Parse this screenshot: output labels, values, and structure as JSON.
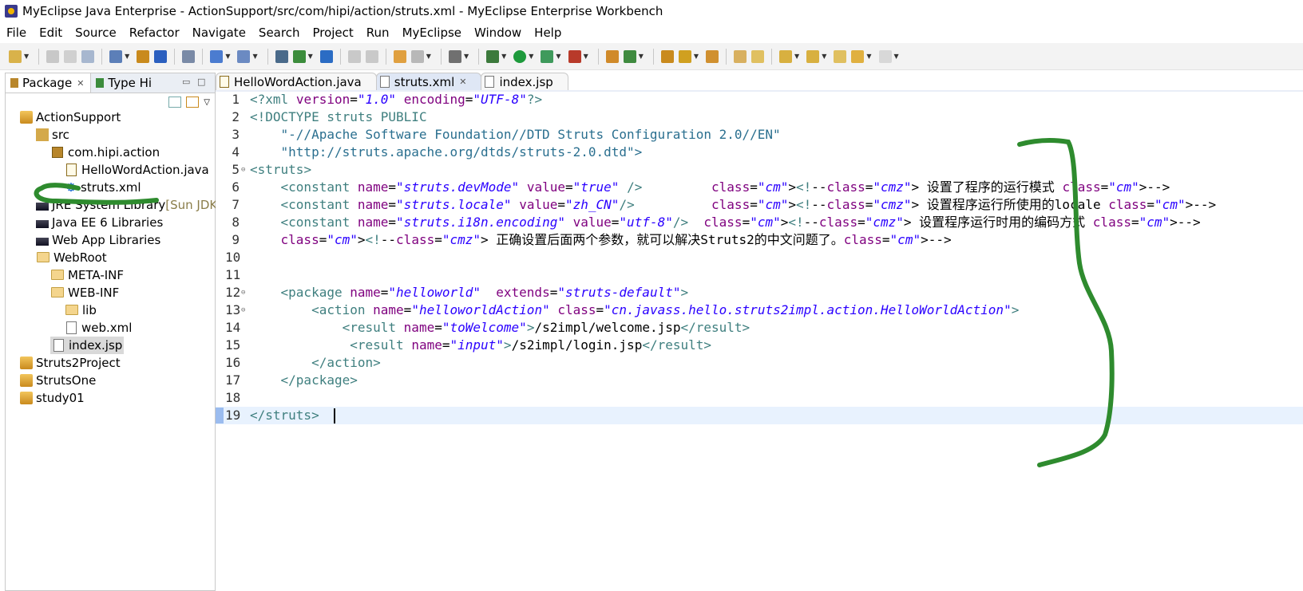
{
  "window": {
    "title": "MyEclipse Java Enterprise - ActionSupport/src/com/hipi/action/struts.xml - MyEclipse Enterprise Workbench"
  },
  "menu": [
    "File",
    "Edit",
    "Source",
    "Refactor",
    "Navigate",
    "Search",
    "Project",
    "Run",
    "MyEclipse",
    "Window",
    "Help"
  ],
  "left_panel": {
    "tabs": [
      {
        "label": "Package",
        "active": true
      },
      {
        "label": "Type Hi",
        "active": false
      }
    ],
    "tree": [
      {
        "label": "ActionSupport",
        "icon": "project-icon"
      },
      {
        "label": "src",
        "icon": "source-folder-icon"
      },
      {
        "label": "com.hipi.action",
        "icon": "package-icon"
      },
      {
        "label": "HelloWordAction.java",
        "icon": "java-file-icon"
      },
      {
        "label": "struts.xml",
        "icon": "xml-config-icon"
      },
      {
        "label": "JRE System Library",
        "suffix": " [Sun JDK",
        "icon": "library-icon"
      },
      {
        "label": "Java EE 6 Libraries",
        "icon": "library-icon"
      },
      {
        "label": "Web App Libraries",
        "icon": "library-icon"
      },
      {
        "label": "WebRoot",
        "icon": "folder-icon"
      },
      {
        "label": "META-INF",
        "icon": "folder-icon"
      },
      {
        "label": "WEB-INF",
        "icon": "folder-icon"
      },
      {
        "label": "lib",
        "icon": "folder-icon"
      },
      {
        "label": "web.xml",
        "icon": "xml-file-icon"
      },
      {
        "label": "index.jsp",
        "icon": "jsp-file-icon",
        "selected": true
      },
      {
        "label": "Struts2Project",
        "icon": "project-icon"
      },
      {
        "label": "StrutsOne",
        "icon": "project-icon"
      },
      {
        "label": "study01",
        "icon": "project-icon"
      }
    ]
  },
  "editor": {
    "tabs": [
      {
        "label": "HelloWordAction.java",
        "active": false
      },
      {
        "label": "struts.xml",
        "active": true
      },
      {
        "label": "index.jsp",
        "active": false
      }
    ],
    "lines": [
      {
        "n": "1",
        "text": "<?xml version=\"1.0\" encoding=\"UTF-8\"?>"
      },
      {
        "n": "2",
        "text": "<!DOCTYPE struts PUBLIC"
      },
      {
        "n": "3",
        "text": "    \"-//Apache Software Foundation//DTD Struts Configuration 2.0//EN\""
      },
      {
        "n": "4",
        "text": "    \"http://struts.apache.org/dtds/struts-2.0.dtd\">"
      },
      {
        "n": "5",
        "text": "<struts>"
      },
      {
        "n": "6",
        "text": "    <constant name=\"struts.devMode\" value=\"true\" />         <!-- 设置了程序的运行模式 -->"
      },
      {
        "n": "7",
        "text": "    <constant name=\"struts.locale\" value=\"zh_CN\"/>          <!-- 设置程序运行所使用的locale -->"
      },
      {
        "n": "8",
        "text": "    <constant name=\"struts.i18n.encoding\" value=\"utf-8\"/>  <!-- 设置程序运行时用的编码方式 -->"
      },
      {
        "n": "9",
        "text": "    <!-- 正确设置后面两个参数，就可以解决Struts2的中文问题了。-->"
      },
      {
        "n": "10",
        "text": ""
      },
      {
        "n": "11",
        "text": ""
      },
      {
        "n": "12",
        "text": "    <package name=\"helloworld\"  extends=\"struts-default\">"
      },
      {
        "n": "13",
        "text": "        <action name=\"helloworldAction\" class=\"cn.javass.hello.struts2impl.action.HelloWorldAction\">"
      },
      {
        "n": "14",
        "text": "            <result name=\"toWelcome\">/s2impl/welcome.jsp</result>"
      },
      {
        "n": "15",
        "text": "             <result name=\"input\">/s2impl/login.jsp</result>"
      },
      {
        "n": "16",
        "text": "        </action>"
      },
      {
        "n": "17",
        "text": "    </package>"
      },
      {
        "n": "18",
        "text": ""
      },
      {
        "n": "19",
        "text": "</struts> "
      }
    ],
    "current_line": "19"
  },
  "colors": {
    "tag": "#3f7f7f",
    "attr_name": "#7f007f",
    "attr_value": "#2a00ff",
    "comment": "#3f5fbf",
    "annotation": "#2e8b2e"
  }
}
